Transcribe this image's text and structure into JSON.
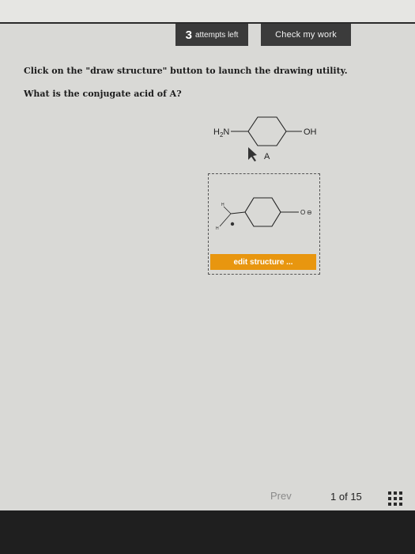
{
  "header": {
    "attempts_number": "3",
    "attempts_label": "attempts left",
    "check_label": "Check my work"
  },
  "question": {
    "instruction": "Click on the \"draw structure\" button to launch the drawing utility.",
    "prompt": "What is the conjugate acid of A?"
  },
  "molecule_a": {
    "left_group": "H2N",
    "right_group": "OH",
    "label": "A"
  },
  "drawn_structure": {
    "atom_h_top": "H",
    "atom_h_bottom": "H",
    "right_group": "O",
    "charge": "⊖"
  },
  "edit_button_label": "edit structure ...",
  "pager": {
    "prev_label": "Prev",
    "current": "1",
    "of_label": "of",
    "total": "15"
  },
  "colors": {
    "edit_button": "#e8960f",
    "dark_button": "#3b3b3b",
    "background": "#d9d9d6"
  },
  "icons": {
    "grid": "grid-icon",
    "cursor": "cursor-arrow-icon"
  }
}
